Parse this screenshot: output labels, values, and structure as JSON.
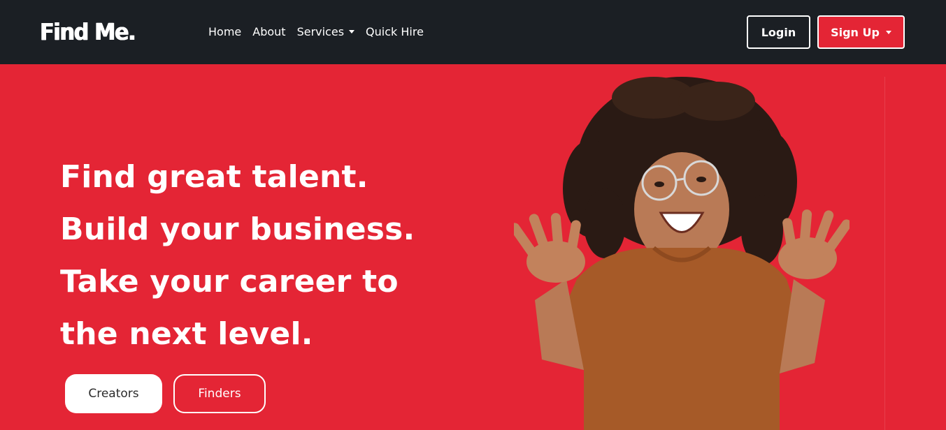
{
  "header": {
    "brand": "Find Me.",
    "nav": {
      "home": "Home",
      "about": "About",
      "services": "Services",
      "quick_hire": "Quick Hire"
    },
    "login": "Login",
    "signup": "Sign Up"
  },
  "hero": {
    "lines": [
      "Find great talent.",
      "Build your business.",
      "Take your career to",
      "the next level."
    ],
    "creators": "Creators",
    "finders": "Finders"
  },
  "colors": {
    "navbar": "#1b1f24",
    "accent": "#e42535",
    "shirt": "#a65a28",
    "hair": "#2a1a14",
    "skin": "#b97a56"
  },
  "icons": [
    "dropdown-caret-icon"
  ]
}
